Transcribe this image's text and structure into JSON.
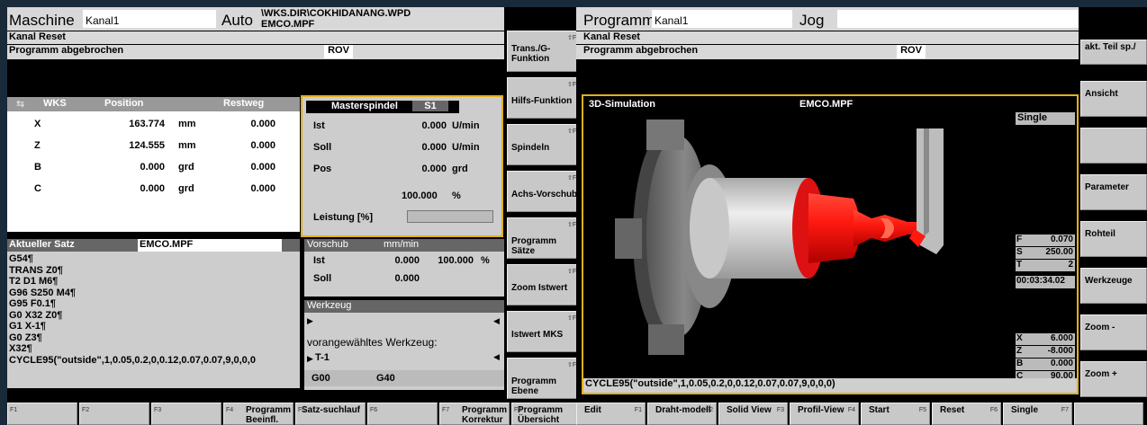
{
  "left": {
    "header": {
      "mode": "Maschine",
      "channel": "Kanal1",
      "op_mode": "Auto",
      "path_line1": "\\WKS.DIR\\COKHIDANANG.WPD",
      "path_line2": "EMCO.MPF"
    },
    "status1": "Kanal Reset",
    "status2": "Programm abgebrochen",
    "rov": "ROV",
    "wks": {
      "col_wks": "WKS",
      "col_pos": "Position",
      "col_rest": "Restweg",
      "rows": [
        {
          "axis": "X",
          "pos": "163.774",
          "unit": "mm",
          "rest": "0.000"
        },
        {
          "axis": "Z",
          "pos": "124.555",
          "unit": "mm",
          "rest": "0.000"
        },
        {
          "axis": "B",
          "pos": "0.000",
          "unit": "grd",
          "rest": "0.000"
        },
        {
          "axis": "C",
          "pos": "0.000",
          "unit": "grd",
          "rest": "0.000"
        }
      ]
    },
    "spindle": {
      "title": "Masterspindel",
      "id": "S1",
      "rows": [
        {
          "label": "Ist",
          "value": "0.000",
          "unit": "U/min"
        },
        {
          "label": "Soll",
          "value": "0.000",
          "unit": "U/min"
        },
        {
          "label": "Pos",
          "value": "0.000",
          "unit": "grd"
        }
      ],
      "percent": "100.000",
      "percent_unit": "%",
      "power_label": "Leistung [%]"
    },
    "block": {
      "title": "Aktueller Satz",
      "program": "EMCO.MPF",
      "lines": [
        "G54¶",
        "TRANS Z0¶",
        "T2 D1 M6¶",
        "G96 S250 M4¶",
        "G95 F0.1¶",
        "G0 X32 Z0¶",
        "G1 X-1¶",
        "G0 Z3¶",
        "X32¶",
        "CYCLE95(\"outside\",1,0.05,0.2,0,0.12,0.07,0.07,9,0,0,0"
      ]
    },
    "feed": {
      "title": "Vorschub",
      "unit": "mm/min",
      "rows": [
        {
          "label": "Ist",
          "value": "0.000",
          "pct": "100.000",
          "pct_unit": "%"
        },
        {
          "label": "Soll",
          "value": "0.000",
          "pct": "",
          "pct_unit": ""
        }
      ]
    },
    "tool": {
      "title": "Werkzeug",
      "preselected_label": "vorangewähltes Werkzeug:",
      "preselected_value": "T-1",
      "g1": "G00",
      "g2": "G40"
    },
    "softkeys_right": [
      {
        "label": "Trans./G-Funktion",
        "f": "F1"
      },
      {
        "label": "Hilfs-Funktion",
        "f": "F2"
      },
      {
        "label": "Spindeln",
        "f": "F3"
      },
      {
        "label": "Achs-Vorschub",
        "f": "F4"
      },
      {
        "label": "Programm Sätze",
        "f": "F5"
      },
      {
        "label": "Zoom Istwert",
        "f": "F6"
      },
      {
        "label": "Istwert MKS",
        "f": "F7"
      },
      {
        "label": "Programm Ebene",
        "f": "F8"
      }
    ],
    "softkeys_bottom": [
      {
        "label": "",
        "f": "F1"
      },
      {
        "label": "",
        "f": "F2"
      },
      {
        "label": "",
        "f": "F3"
      },
      {
        "label": "Programm Beeinfl.",
        "f": "F4"
      },
      {
        "label": "Satz-suchlauf",
        "f": "F5"
      },
      {
        "label": "",
        "f": "F6"
      },
      {
        "label": "Programm Korrektur",
        "f": "F7"
      },
      {
        "label": "Programm Übersicht",
        "f": "F8"
      }
    ]
  },
  "right": {
    "header": {
      "mode": "Programm",
      "channel": "Kanal1",
      "op_mode": "Jog"
    },
    "status1": "Kanal Reset",
    "status2": "Programm abgebrochen",
    "rov": "ROV",
    "side_top": "akt. Teil sp./",
    "sim": {
      "title": "3D-Simulation",
      "program": "EMCO.MPF",
      "mode": "Single",
      "cycle": "CYCLE95(\"outside\",1,0.05,0.2,0,0.12,0.07,0.07,9,0,0,0)"
    },
    "params": [
      {
        "k": "F",
        "v": "0.070"
      },
      {
        "k": "S",
        "v": "250.00"
      },
      {
        "k": "T",
        "v": "2"
      }
    ],
    "time": "00:03:34.02",
    "coords": [
      {
        "k": "X",
        "v": "6.000"
      },
      {
        "k": "Z",
        "v": "-8.000"
      },
      {
        "k": "B",
        "v": "0.000"
      },
      {
        "k": "C",
        "v": "90.00"
      }
    ],
    "softkeys_right": [
      {
        "label": "Ansicht"
      },
      {
        "label": ""
      },
      {
        "label": "Parameter"
      },
      {
        "label": "Rohteil"
      },
      {
        "label": "Werkzeuge"
      },
      {
        "label": "Zoom -"
      },
      {
        "label": "Zoom +"
      }
    ],
    "softkeys_bottom": [
      {
        "label": "Edit",
        "f": "F1"
      },
      {
        "label": "Draht-modell",
        "f": "F2"
      },
      {
        "label": "Solid View",
        "f": "F3"
      },
      {
        "label": "Profil-View",
        "f": "F4"
      },
      {
        "label": "Start",
        "f": "F5"
      },
      {
        "label": "Reset",
        "f": "F6"
      },
      {
        "label": "Single",
        "f": "F7"
      },
      {
        "label": "",
        "f": ""
      }
    ]
  },
  "colors": {
    "accent_frame": "#e0b020",
    "sim_red": "#e01010",
    "panel_gray": "#cdcdcd",
    "header_gray": "#d8d8d8"
  }
}
